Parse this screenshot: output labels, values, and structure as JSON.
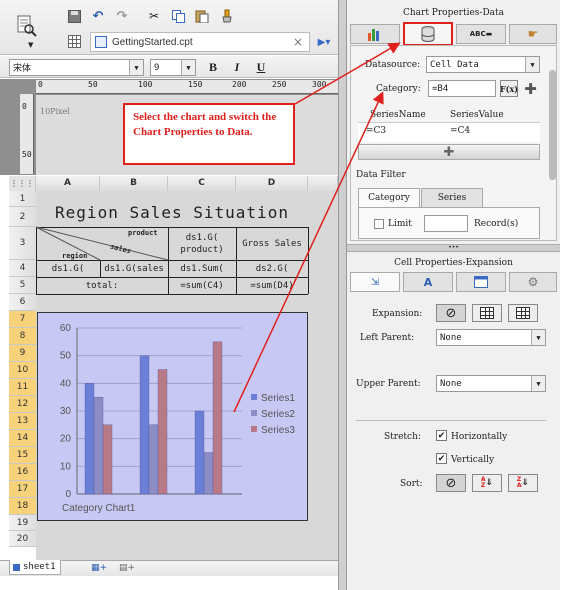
{
  "toolbar": {
    "tab_title": "GettingStarted.cpt",
    "tab_close": "×",
    "font_name": "宋体",
    "font_size": "9",
    "bold": "B",
    "italic": "I",
    "underline": "U"
  },
  "ruler": {
    "ticks": [
      "0",
      "50",
      "100",
      "150",
      "200",
      "250",
      "300"
    ],
    "label": "10Pixel",
    "vticks": [
      "0",
      "50"
    ]
  },
  "callout": {
    "text": "Select the chart and switch the Chart Properties to Data."
  },
  "sheet": {
    "columns": [
      "A",
      "B",
      "C",
      "D"
    ],
    "rows": [
      "1",
      "2",
      "3",
      "4",
      "5",
      "6",
      "7",
      "8",
      "9",
      "10",
      "11",
      "12",
      "13",
      "14",
      "15",
      "16",
      "17",
      "18",
      "19",
      "20"
    ],
    "title": "Region Sales Situation",
    "header_product": "product",
    "header_sales": "sales",
    "header_region": "region",
    "c3": "ds1.G(\nproduct)",
    "d3": "Gross Sales",
    "a4": "ds1.G(",
    "b4": "ds1.G(sales",
    "c4": "ds1.Sum(",
    "d4": "ds2.G(",
    "total": "total:",
    "c5": "=sum(C4)",
    "d5": "=sum(D4)",
    "sheet_tab": "sheet1"
  },
  "chart_data": {
    "type": "bar",
    "title": "",
    "xlabel": "Category Chart1",
    "ylabel": "",
    "ylim": [
      0,
      60
    ],
    "yticks": [
      "0",
      "10",
      "20",
      "30",
      "40",
      "50",
      "60"
    ],
    "categories": [
      "",
      "",
      ""
    ],
    "series": [
      {
        "name": "Series1",
        "values": [
          40,
          50,
          30
        ],
        "color": "#6a7fd6"
      },
      {
        "name": "Series2",
        "values": [
          35,
          25,
          15
        ],
        "color": "#8c8cc6"
      },
      {
        "name": "Series3",
        "values": [
          25,
          45,
          55
        ],
        "color": "#b87a86"
      }
    ],
    "legend": "right",
    "grid": true
  },
  "chart_props": {
    "title": "Chart Properties-Data",
    "datasource_label": "Datasource:",
    "datasource_value": "Cell Data",
    "category_label": "Category:",
    "category_value": "=B4",
    "fx": "F(x)",
    "series_name_header": "SeriesName",
    "series_value_header": "SeriesValue",
    "series_name": "=C3",
    "series_value": "=C4",
    "data_filter": "Data Filter",
    "tab_category": "Category",
    "tab_series": "Series",
    "limit_label": "Limit",
    "records_label": "Record(s)"
  },
  "cell_props": {
    "title": "Cell Properties-Expansion",
    "expansion_label": "Expansion:",
    "left_parent_label": "Left Parent:",
    "left_parent_value": "None",
    "upper_parent_label": "Upper Parent:",
    "upper_parent_value": "None",
    "stretch_label": "Stretch:",
    "horizontally": "Horizontally",
    "vertically": "Vertically",
    "sort_label": "Sort:"
  },
  "colors": {
    "accent_red": "#e0201c",
    "chart_bg": "#c8c8f4",
    "selected_row": "#f7d27a"
  }
}
